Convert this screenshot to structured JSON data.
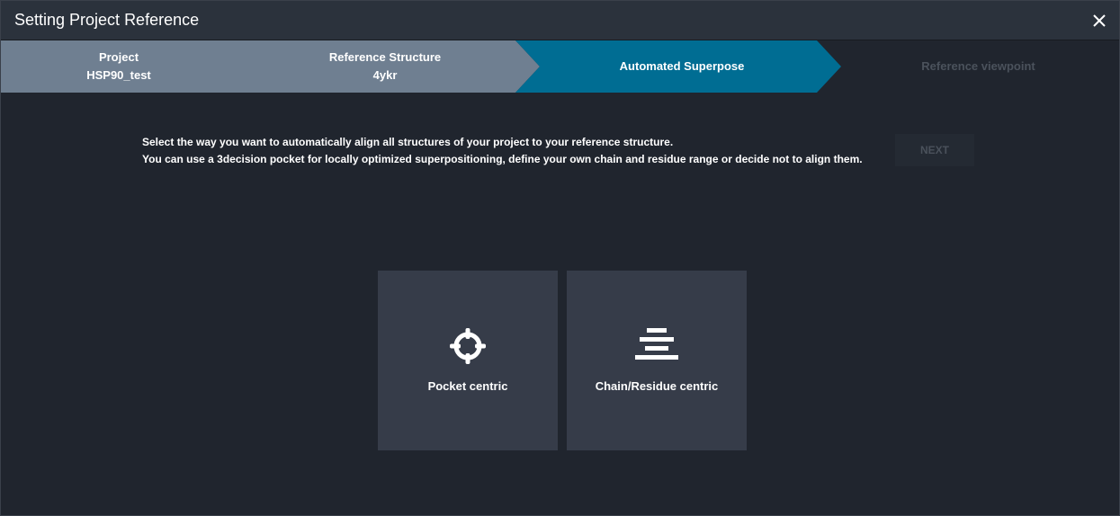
{
  "dialog": {
    "title": "Setting Project Reference",
    "close_icon": "close-icon"
  },
  "steps": [
    {
      "label": "Project",
      "value": "HSP90_test",
      "state": "completed"
    },
    {
      "label": "Reference Structure",
      "value": "4ykr",
      "state": "completed"
    },
    {
      "label": "Automated Superpose",
      "value": "",
      "state": "active"
    },
    {
      "label": "Reference viewpoint",
      "value": "",
      "state": "pending"
    }
  ],
  "instructions": {
    "line1": "Select the way you want to automatically align all structures of your project to your reference structure.",
    "line2": "You can use a 3decision pocket for locally optimized superpositioning, define your own chain and residue range or decide not to align them."
  },
  "next_button": {
    "label": "NEXT",
    "enabled": false
  },
  "options": [
    {
      "label": "Pocket centric",
      "icon": "crosshair-icon"
    },
    {
      "label": "Chain/Residue centric",
      "icon": "align-center-icon"
    }
  ],
  "colors": {
    "completed_step": "#6f7f91",
    "active_step": "#006d93",
    "background": "#20252e",
    "card": "#363c49"
  }
}
